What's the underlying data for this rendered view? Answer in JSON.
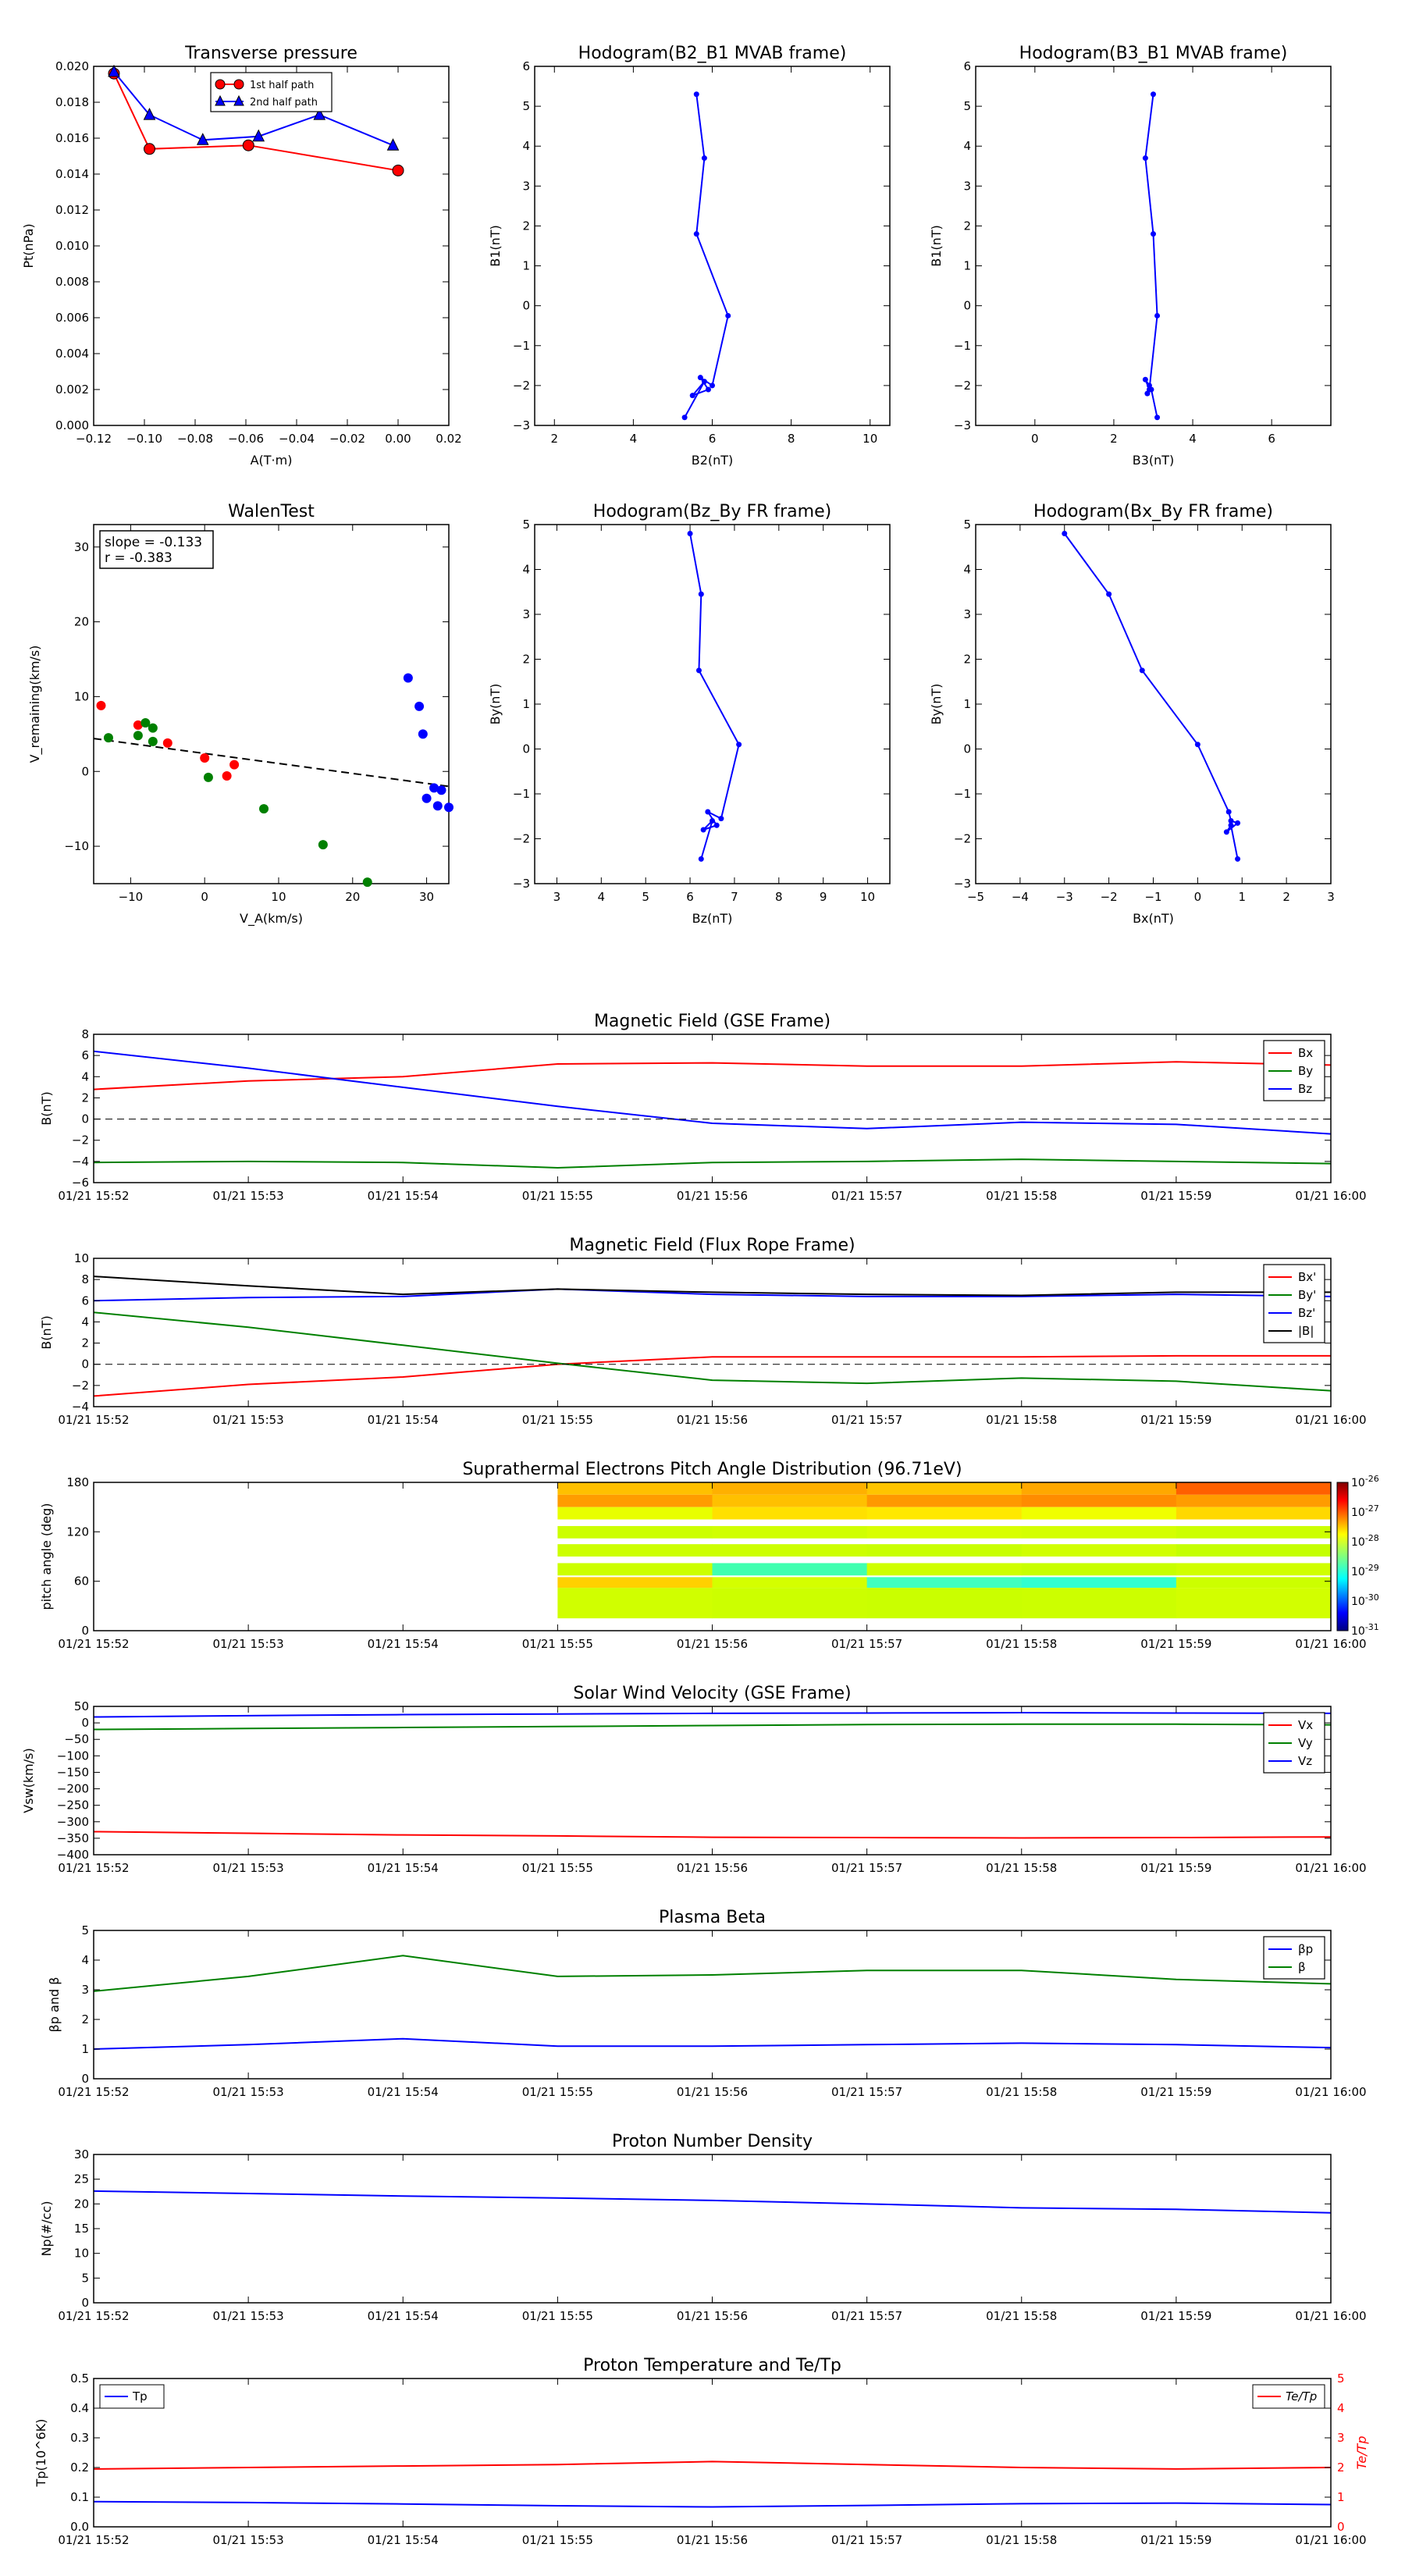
{
  "time_ticks": [
    "01/21 15:52",
    "01/21 15:53",
    "01/21 15:54",
    "01/21 15:55",
    "01/21 15:56",
    "01/21 15:57",
    "01/21 15:58",
    "01/21 15:59",
    "01/21 16:00"
  ],
  "colors": {
    "red": "#ff0000",
    "green": "#008000",
    "blue": "#0000ff",
    "black": "#000000"
  },
  "chart_data": [
    {
      "id": "pt",
      "type": "line",
      "title": "Transverse pressure",
      "xlabel": "A(T·m)",
      "ylabel": "Pt(nPa)",
      "xlim": [
        -0.12,
        0.02
      ],
      "ylim": [
        0,
        0.02
      ],
      "xticks": [
        -0.12,
        -0.1,
        -0.08,
        -0.06,
        -0.04,
        -0.02,
        0.0,
        0.02
      ],
      "xtick_labels": [
        "−0.12",
        "−0.10",
        "−0.08",
        "−0.06",
        "−0.04",
        "−0.02",
        "0.00",
        "0.02"
      ],
      "yticks": [
        0,
        0.002,
        0.004,
        0.006,
        0.008,
        0.01,
        0.012,
        0.014,
        0.016,
        0.018,
        0.02
      ],
      "ytick_labels": [
        "0.000",
        "0.002",
        "0.004",
        "0.006",
        "0.008",
        "0.010",
        "0.012",
        "0.014",
        "0.016",
        "0.018",
        "0.020"
      ],
      "legend": "top-center",
      "series": [
        {
          "name": "1st half path",
          "color": "#ff0000",
          "marker": "circle",
          "x": [
            -0.112,
            -0.098,
            -0.059,
            0.0
          ],
          "y": [
            0.0196,
            0.0154,
            0.0156,
            0.0142
          ]
        },
        {
          "name": "2nd half path",
          "color": "#0000ff",
          "marker": "triangle",
          "x": [
            -0.112,
            -0.098,
            -0.077,
            -0.055,
            -0.031,
            -0.002
          ],
          "y": [
            0.0197,
            0.0173,
            0.0159,
            0.0161,
            0.0173,
            0.0156
          ]
        }
      ]
    },
    {
      "id": "hodo_b2b1",
      "type": "line",
      "title": "Hodogram(B2_B1 MVAB frame)",
      "xlabel": "B2(nT)",
      "ylabel": "B1(nT)",
      "xlim": [
        1.5,
        10.5
      ],
      "ylim": [
        -3,
        6
      ],
      "xticks": [
        2,
        4,
        6,
        8,
        10
      ],
      "yticks": [
        -3,
        -2,
        -1,
        0,
        1,
        2,
        3,
        4,
        5,
        6
      ],
      "series": [
        {
          "color": "#0000ff",
          "marker": "dot",
          "x": [
            5.6,
            5.8,
            5.6,
            6.4,
            6.0,
            5.7,
            5.9,
            5.5,
            5.8,
            5.3
          ],
          "y": [
            5.3,
            3.7,
            1.8,
            -0.25,
            -2.0,
            -1.8,
            -2.1,
            -2.25,
            -1.9,
            -2.8
          ]
        }
      ]
    },
    {
      "id": "hodo_b3b1",
      "type": "line",
      "title": "Hodogram(B3_B1 MVAB frame)",
      "xlabel": "B3(nT)",
      "ylabel": "B1(nT)",
      "xlim": [
        -1.5,
        7.5
      ],
      "ylim": [
        -3,
        6
      ],
      "xticks": [
        0,
        2,
        4,
        6
      ],
      "yticks": [
        -3,
        -2,
        -1,
        0,
        1,
        2,
        3,
        4,
        5,
        6
      ],
      "series": [
        {
          "color": "#0000ff",
          "marker": "dot",
          "x": [
            3.0,
            2.8,
            3.0,
            3.1,
            2.9,
            2.8,
            2.9,
            2.85,
            2.95,
            3.1
          ],
          "y": [
            5.3,
            3.7,
            1.8,
            -0.25,
            -2.1,
            -1.85,
            -2.0,
            -2.2,
            -2.1,
            -2.8
          ]
        }
      ]
    },
    {
      "id": "walen",
      "type": "scatter",
      "title": "WalenTest",
      "xlabel": "V_A(km/s)",
      "ylabel": "V_remaining(km/s)",
      "xlim": [
        -15,
        33
      ],
      "ylim": [
        -15,
        33
      ],
      "xticks": [
        -10,
        0,
        10,
        20,
        30
      ],
      "yticks": [
        -10,
        0,
        10,
        20,
        30
      ],
      "annotation": [
        "slope = -0.133",
        "r = -0.383"
      ],
      "fit_line": {
        "x": [
          -15,
          33
        ],
        "y": [
          4.4,
          -2.0
        ]
      },
      "series": [
        {
          "color": "#ff0000",
          "x": [
            -14,
            -9,
            -5,
            0,
            3,
            4
          ],
          "y": [
            8.8,
            6.2,
            3.8,
            1.8,
            -0.6,
            0.9
          ]
        },
        {
          "color": "#008000",
          "x": [
            -13,
            -9,
            -8,
            -7,
            -7,
            0.5,
            8,
            16,
            22
          ],
          "y": [
            4.5,
            4.8,
            6.5,
            4,
            5.8,
            -0.8,
            -5,
            -9.8,
            -14.8
          ]
        },
        {
          "color": "#0000ff",
          "x": [
            27.5,
            29,
            29.5,
            30,
            31,
            31.5,
            32,
            33
          ],
          "y": [
            12.5,
            8.7,
            5,
            -3.6,
            -2.2,
            -4.6,
            -2.5,
            -4.8
          ]
        }
      ]
    },
    {
      "id": "hodo_bzby",
      "type": "line",
      "title": "Hodogram(Bz_By FR frame)",
      "xlabel": "Bz(nT)",
      "ylabel": "By(nT)",
      "xlim": [
        2.5,
        10.5
      ],
      "ylim": [
        -3,
        5
      ],
      "xticks": [
        3,
        4,
        5,
        6,
        7,
        8,
        9,
        10
      ],
      "yticks": [
        -3,
        -2,
        -1,
        0,
        1,
        2,
        3,
        4,
        5
      ],
      "series": [
        {
          "color": "#0000ff",
          "marker": "dot",
          "x": [
            6.0,
            6.25,
            6.2,
            7.1,
            6.7,
            6.4,
            6.6,
            6.3,
            6.5,
            6.25
          ],
          "y": [
            4.8,
            3.45,
            1.75,
            0.1,
            -1.55,
            -1.4,
            -1.7,
            -1.8,
            -1.6,
            -2.45
          ]
        }
      ]
    },
    {
      "id": "hodo_bxby",
      "type": "line",
      "title": "Hodogram(Bx_By FR frame)",
      "xlabel": "Bx(nT)",
      "ylabel": "By(nT)",
      "xlim": [
        -5,
        3
      ],
      "ylim": [
        -3,
        5
      ],
      "xticks": [
        -5,
        -4,
        -3,
        -2,
        -1,
        0,
        1,
        2,
        3
      ],
      "yticks": [
        -3,
        -2,
        -1,
        0,
        1,
        2,
        3,
        4,
        5
      ],
      "series": [
        {
          "color": "#0000ff",
          "marker": "dot",
          "x": [
            -3.0,
            -2.0,
            -1.25,
            0.0,
            0.7,
            0.75,
            0.9,
            0.65,
            0.75,
            0.9
          ],
          "y": [
            4.8,
            3.45,
            1.75,
            0.1,
            -1.4,
            -1.6,
            -1.65,
            -1.85,
            -1.7,
            -2.45
          ]
        }
      ]
    },
    {
      "id": "mag_gse",
      "type": "line",
      "title": "Magnetic Field (GSE Frame)",
      "ylabel": "B(nT)",
      "ylim": [
        -6,
        8
      ],
      "yticks": [
        -6,
        -4,
        -2,
        0,
        2,
        4,
        6,
        8
      ],
      "zero_line": true,
      "legend": "top-right",
      "series": [
        {
          "name": "Bx",
          "color": "#ff0000",
          "values": [
            2.8,
            3.6,
            4.0,
            5.2,
            5.3,
            5.0,
            5.0,
            5.4,
            5.1
          ]
        },
        {
          "name": "By",
          "color": "#008000",
          "values": [
            -4.1,
            -4.0,
            -4.1,
            -4.6,
            -4.1,
            -4.0,
            -3.8,
            -4.0,
            -4.2
          ]
        },
        {
          "name": "Bz",
          "color": "#0000ff",
          "values": [
            6.4,
            4.8,
            3.0,
            1.2,
            -0.4,
            -0.9,
            -0.3,
            -0.5,
            -1.4
          ]
        }
      ]
    },
    {
      "id": "mag_fr",
      "type": "line",
      "title": "Magnetic Field (Flux Rope Frame)",
      "ylabel": "B(nT)",
      "ylim": [
        -4,
        10
      ],
      "yticks": [
        -4,
        -2,
        0,
        2,
        4,
        6,
        8,
        10
      ],
      "zero_line": true,
      "legend": "top-right",
      "series": [
        {
          "name": "Bx'",
          "color": "#ff0000",
          "values": [
            -3.0,
            -1.9,
            -1.2,
            0.0,
            0.7,
            0.7,
            0.7,
            0.8,
            0.8
          ]
        },
        {
          "name": "By'",
          "color": "#008000",
          "values": [
            4.9,
            3.5,
            1.8,
            0.1,
            -1.5,
            -1.8,
            -1.3,
            -1.6,
            -2.5
          ]
        },
        {
          "name": "Bz'",
          "color": "#0000ff",
          "values": [
            6.0,
            6.3,
            6.4,
            7.1,
            6.6,
            6.4,
            6.4,
            6.6,
            6.4
          ]
        },
        {
          "name": "|B|",
          "color": "#000000",
          "values": [
            8.3,
            7.4,
            6.6,
            7.1,
            6.8,
            6.6,
            6.5,
            6.8,
            6.8
          ]
        }
      ]
    },
    {
      "id": "pad",
      "type": "heatmap",
      "title": "Suprathermal Electrons Pitch Angle Distribution (96.71eV)",
      "ylabel": "pitch angle (deg)",
      "ylim": [
        0,
        180
      ],
      "yticks": [
        0,
        60,
        120,
        180
      ],
      "colorbar": {
        "labels": [
          "10^-26",
          "10^-27",
          "10^-28",
          "10^-29",
          "10^-30",
          "10^-31"
        ]
      },
      "time_columns": [
        3,
        4,
        5,
        6,
        7
      ],
      "rows": [
        {
          "pa": [
            165,
            180
          ],
          "colors": [
            "#ffc000",
            "#ffb000",
            "#ffc400",
            "#ffa800",
            "#ff6000"
          ]
        },
        {
          "pa": [
            150,
            165
          ],
          "colors": [
            "#ff9c00",
            "#ffc000",
            "#ff9800",
            "#ff8c00",
            "#ff9c00"
          ]
        },
        {
          "pa": [
            135,
            150
          ],
          "colors": [
            "#e8ff00",
            "#ffe000",
            "#ffe800",
            "#f0ff00",
            "#ffd800"
          ]
        },
        {
          "pa": [
            112,
            127
          ],
          "colors": [
            "#ccff00",
            "#d0ff00",
            "#d8ff00",
            "#d4ff00",
            "#ccff00"
          ]
        },
        {
          "pa": [
            90,
            105
          ],
          "colors": [
            "#ccff00",
            "#ccff00",
            "#c8ff00",
            "#d0ff00",
            "#c4ff00"
          ]
        },
        {
          "pa": [
            67,
            82
          ],
          "colors": [
            "#ccff00",
            "#40ffb0",
            "#cfff00",
            "#c8ff00",
            "#d0ff00"
          ]
        },
        {
          "pa": [
            52,
            65
          ],
          "colors": [
            "#ffd000",
            "#d4ff00",
            "#40ffc0",
            "#30ffd0",
            "#ccff00"
          ]
        },
        {
          "pa": [
            15,
            52
          ],
          "colors": [
            "#d0ff00",
            "#ccff00",
            "#caff00",
            "#ccff00",
            "#d2ff00"
          ]
        }
      ]
    },
    {
      "id": "vsw",
      "type": "line",
      "title": "Solar Wind Velocity (GSE Frame)",
      "ylabel": "Vsw(km/s)",
      "ylim": [
        -400,
        50
      ],
      "yticks": [
        -400,
        -350,
        -300,
        -250,
        -200,
        -150,
        -100,
        -50,
        0,
        50
      ],
      "legend": "top-right",
      "series": [
        {
          "name": "Vx",
          "color": "#ff0000",
          "values": [
            -330,
            -335,
            -340,
            -343,
            -347,
            -348,
            -349,
            -348,
            -346
          ]
        },
        {
          "name": "Vy",
          "color": "#008000",
          "values": [
            -20,
            -17,
            -14,
            -11,
            -8,
            -5,
            -4,
            -4,
            -6
          ]
        },
        {
          "name": "Vz",
          "color": "#0000ff",
          "values": [
            18,
            22,
            25,
            27,
            29,
            30,
            31,
            30,
            29
          ]
        }
      ]
    },
    {
      "id": "beta",
      "type": "line",
      "title": "Plasma Beta",
      "ylabel": "βp and β",
      "ylim": [
        0,
        5
      ],
      "yticks": [
        0,
        1,
        2,
        3,
        4,
        5
      ],
      "legend": "top-right",
      "series": [
        {
          "name": "βp",
          "color": "#0000ff",
          "values": [
            1.0,
            1.15,
            1.35,
            1.1,
            1.1,
            1.15,
            1.2,
            1.15,
            1.05
          ]
        },
        {
          "name": "β",
          "color": "#008000",
          "values": [
            2.95,
            3.45,
            4.15,
            3.45,
            3.5,
            3.65,
            3.65,
            3.35,
            3.2
          ]
        }
      ]
    },
    {
      "id": "np",
      "type": "line",
      "title": "Proton Number Density",
      "ylabel": "Np(#/cc)",
      "ylim": [
        0,
        30
      ],
      "yticks": [
        0,
        5,
        10,
        15,
        20,
        25,
        30
      ],
      "series": [
        {
          "color": "#0000ff",
          "values": [
            22.6,
            22.1,
            21.6,
            21.2,
            20.7,
            20.0,
            19.2,
            18.9,
            18.2
          ]
        }
      ]
    },
    {
      "id": "tp",
      "type": "line",
      "title": "Proton Temperature and Te/Tp",
      "ylabel": "Tp(10^6K)",
      "ylabel_right": "Te/Tp",
      "ylim": [
        0,
        0.5
      ],
      "yticks": [
        0,
        0.1,
        0.2,
        0.3,
        0.4,
        0.5
      ],
      "ytick_labels": [
        "0.0",
        "0.1",
        "0.2",
        "0.3",
        "0.4",
        "0.5"
      ],
      "ylim_right": [
        0,
        5
      ],
      "yticks_right": [
        0,
        1,
        2,
        3,
        4,
        5
      ],
      "series": [
        {
          "name": "Tp",
          "color": "#0000ff",
          "axis": "left",
          "values": [
            0.085,
            0.082,
            0.077,
            0.071,
            0.067,
            0.072,
            0.078,
            0.08,
            0.075
          ]
        },
        {
          "name": "Te/Tp",
          "color": "#ff0000",
          "axis": "right",
          "values": [
            1.95,
            2.0,
            2.05,
            2.1,
            2.2,
            2.1,
            2.0,
            1.95,
            2.0
          ]
        }
      ]
    }
  ]
}
